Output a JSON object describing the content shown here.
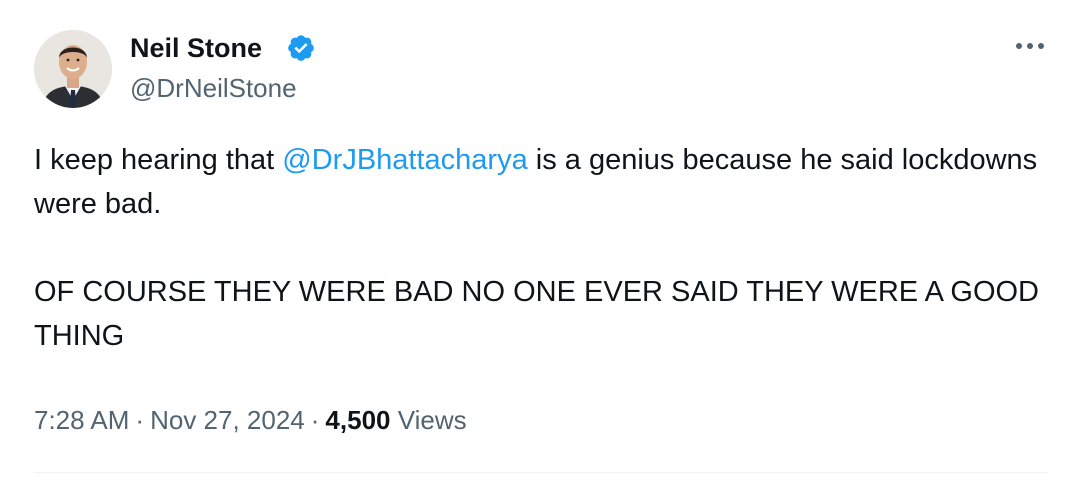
{
  "author": {
    "name": "Neil Stone",
    "handle": "@DrNeilStone",
    "verified": true,
    "avatar": "avatar-photo"
  },
  "tweet": {
    "text_before_mention": "I keep hearing that ",
    "mention": "@DrJBhattacharya",
    "text_after_mention": " is a genius because he said lockdowns were bad.",
    "second_paragraph": "OF COURSE THEY WERE BAD NO ONE EVER SAID THEY WERE A GOOD THING"
  },
  "meta": {
    "time": "7:28 AM",
    "separator": "·",
    "date": "Nov 27, 2024",
    "views_count": "4,500",
    "views_label": "Views"
  },
  "icons": {
    "verified": "verified-badge-icon",
    "more": "more-options-icon"
  },
  "colors": {
    "link": "#1d9bf0",
    "secondary_text": "#536471",
    "primary_text": "#0f1419",
    "verified_badge": "#1d9bf0"
  }
}
